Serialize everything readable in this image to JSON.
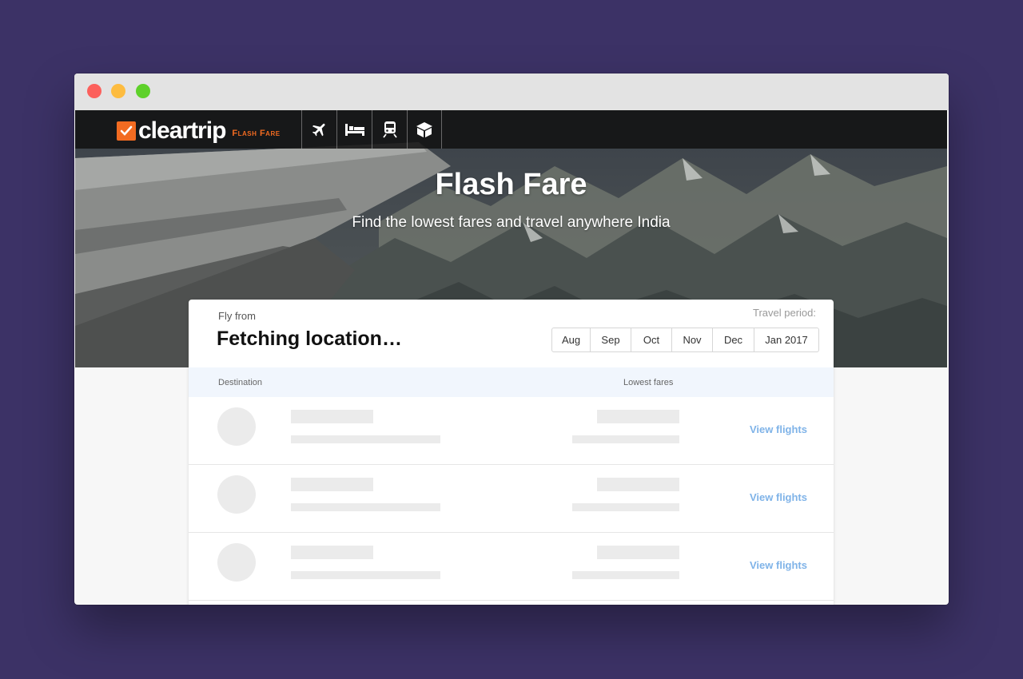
{
  "brand": {
    "name": "cleartrip",
    "tagline": "Flash Fare",
    "accent_color": "#f26b21"
  },
  "nav": {
    "icons": [
      "flight-icon",
      "hotel-icon",
      "train-icon",
      "package-icon"
    ]
  },
  "hero": {
    "title": "Flash Fare",
    "subtitle": "Find the lowest fares and travel anywhere India"
  },
  "search": {
    "fly_from_label": "Fly from",
    "fly_from_value": "Fetching location…",
    "travel_period_label": "Travel period:",
    "months": [
      "Aug",
      "Sep",
      "Oct",
      "Nov",
      "Dec",
      "Jan 2017"
    ]
  },
  "table": {
    "col_destination": "Destination",
    "col_fares": "Lowest fares",
    "rows": [
      {
        "action": "View flights"
      },
      {
        "action": "View flights"
      },
      {
        "action": "View flights"
      }
    ]
  },
  "colors": {
    "background": "#3c3266",
    "link": "#7fb3e8"
  }
}
